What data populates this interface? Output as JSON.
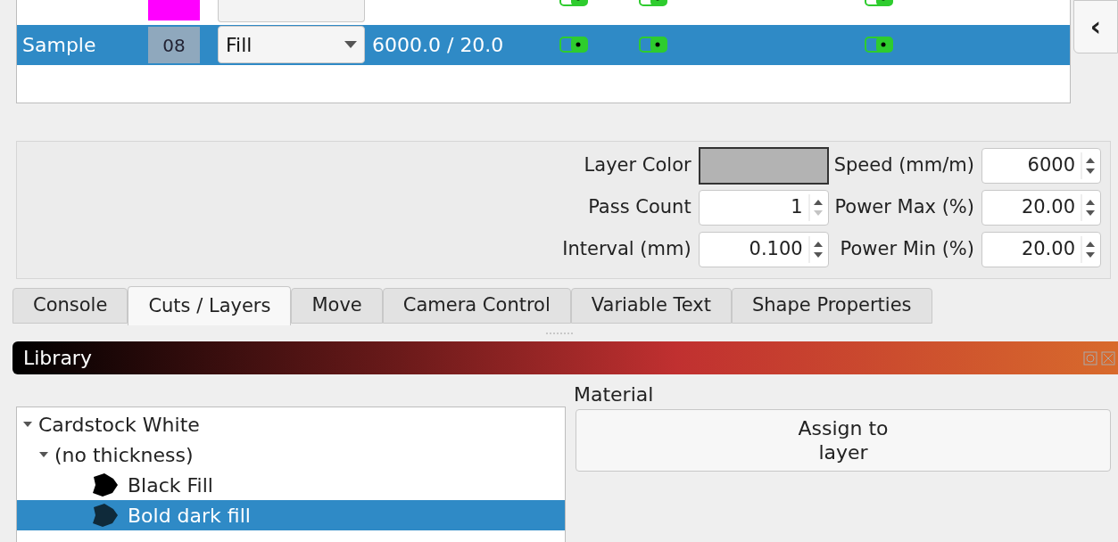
{
  "layers": {
    "rows": [
      {
        "kind": "cut",
        "color": "#ff00ff",
        "toggles": [
          true,
          true,
          true
        ],
        "selected": false
      },
      {
        "kind": "full",
        "name": "Sample",
        "number": "08",
        "color": "#8fa8bd",
        "mode": "Fill",
        "speed_power": "6000.0 / 20.0",
        "toggles": [
          true,
          true,
          true
        ],
        "selected": true
      }
    ]
  },
  "collapse_button": {
    "label": "‹"
  },
  "params": {
    "left": [
      {
        "kind": "color",
        "label": "Layer Color",
        "color": "#b3b3b3"
      },
      {
        "kind": "spin",
        "label": "Pass Count",
        "value": "1",
        "at_min": true
      },
      {
        "kind": "spin",
        "label": "Interval (mm)",
        "value": "0.100",
        "at_min": false
      }
    ],
    "right": [
      {
        "kind": "spin",
        "label": "Speed (mm/m)",
        "value": "6000",
        "at_min": false
      },
      {
        "kind": "spin",
        "label": "Power Max (%)",
        "value": "20.00",
        "at_min": false
      },
      {
        "kind": "spin",
        "label": "Power Min (%)",
        "value": "20.00",
        "at_min": false
      }
    ]
  },
  "tabs": [
    {
      "label": "Console",
      "selected": false
    },
    {
      "label": "Cuts / Layers",
      "selected": true
    },
    {
      "label": "Move",
      "selected": false
    },
    {
      "label": "Camera Control",
      "selected": false
    },
    {
      "label": "Variable Text",
      "selected": false
    },
    {
      "label": "Shape Properties",
      "selected": false
    }
  ],
  "library": {
    "title": "Library",
    "material_label": "Material",
    "assign_button": "Assign to\nlayer",
    "tree": [
      {
        "label": "Cardstock White",
        "expanded": true,
        "selected": false,
        "children": [
          {
            "label": "(no thickness)",
            "expanded": true,
            "selected": false,
            "children": [
              {
                "label": "Black Fill",
                "color": "#000000",
                "selected": false
              },
              {
                "label": "Bold dark fill",
                "color": "#0f2a3a",
                "selected": true
              }
            ]
          }
        ]
      }
    ]
  }
}
